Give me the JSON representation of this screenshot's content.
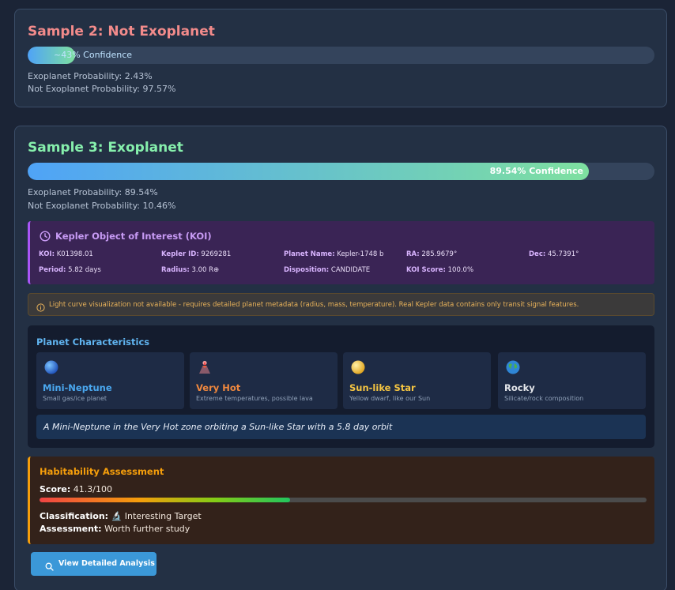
{
  "sample2": {
    "title": "Sample 2: Not Exoplanet",
    "confidence_label": "~43% Confidence",
    "confidence_fraction": 0.076,
    "exoplanet_prob": "Exoplanet Probability: 2.43%",
    "not_exoplanet_prob": "Not Exoplanet Probability: 97.57%"
  },
  "sample3": {
    "title": "Sample 3: Exoplanet",
    "confidence_label": "89.54% Confidence",
    "confidence_fraction": 0.8954,
    "exoplanet_prob": "Exoplanet Probability: 89.54%",
    "not_exoplanet_prob": "Not Exoplanet Probability: 10.46%",
    "koi": {
      "title": "Kepler Object of Interest (KOI)",
      "icon": "clock-icon",
      "fields": {
        "koi": {
          "label": "KOI:",
          "value": " K01398.01"
        },
        "kepler_id": {
          "label": "Kepler ID:",
          "value": " 9269281"
        },
        "planet_name": {
          "label": "Planet Name:",
          "value": " Kepler-1748 b"
        },
        "ra": {
          "label": "RA:",
          "value": " 285.9679°"
        },
        "dec": {
          "label": "Dec:",
          "value": " 45.7391°"
        },
        "period": {
          "label": "Period:",
          "value": " 5.82 days"
        },
        "radius": {
          "label": "Radius:",
          "value": " 3.00 R⊕"
        },
        "disposition": {
          "label": "Disposition:",
          "value": " CANDIDATE"
        },
        "koi_score": {
          "label": "KOI Score:",
          "value": " 100.0%"
        }
      }
    },
    "warning": {
      "icon": "info-icon",
      "text": "Light curve visualization not available - requires detailed planet metadata (radius, mass, temperature). Real Kepler data contains only transit signal features."
    },
    "characteristics": {
      "title": "Planet Characteristics",
      "items": [
        {
          "icon": "blue-planet-icon",
          "name": "Mini-Neptune",
          "desc": "Small gas/ice planet",
          "color": "#4aa8f0"
        },
        {
          "icon": "volcano-icon",
          "name": "Very Hot",
          "desc": "Extreme temperatures, possible lava",
          "color": "#f0883e"
        },
        {
          "icon": "sun-icon",
          "name": "Sun-like Star",
          "desc": "Yellow dwarf, like our Sun",
          "color": "#f5c542"
        },
        {
          "icon": "earth-globe-icon",
          "name": "Rocky",
          "desc": "Silicate/rock composition",
          "color": "#e5e7eb"
        }
      ],
      "summary": "A Mini-Neptune in the Very Hot zone orbiting a Sun-like Star with a 5.8 day orbit"
    },
    "habitability": {
      "title": "Habitability Assessment",
      "score_label": "Score:",
      "score_value": " 41.3/100",
      "score_fraction": 0.413,
      "classification_label": "Classification:",
      "classification_value": " 🔬 Interesting Target",
      "assessment_label": "Assessment:",
      "assessment_value": " Worth further study"
    },
    "button": {
      "label": "View Detailed Analysis",
      "icon": "search-icon"
    }
  }
}
